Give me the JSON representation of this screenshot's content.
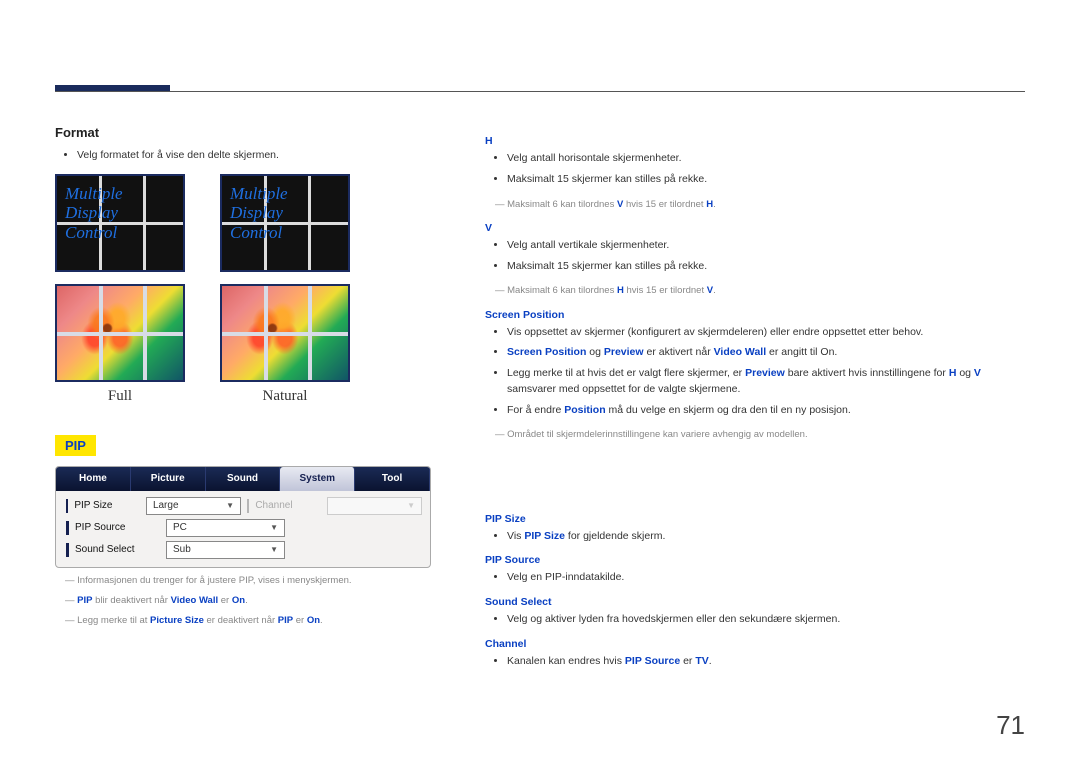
{
  "page_number": "71",
  "left": {
    "format_heading": "Format",
    "format_desc": "Velg formatet for å vise den delte skjermen.",
    "display_text": "Multiple\nDisplay\nControl",
    "label_full": "Full",
    "label_natural": "Natural",
    "pip_heading": "PIP",
    "tabs": {
      "home": "Home",
      "picture": "Picture",
      "sound": "Sound",
      "system": "System",
      "tool": "Tool"
    },
    "rows": {
      "pip_size": {
        "label": "PIP Size",
        "value": "Large"
      },
      "channel": {
        "label": "Channel",
        "value": ""
      },
      "pip_source": {
        "label": "PIP Source",
        "value": "PC"
      },
      "sound_select": {
        "label": "Sound Select",
        "value": "Sub"
      }
    },
    "notes": {
      "n1_pre": "Informasjonen du trenger for å justere PIP, vises i menyskjermen.",
      "n2_a": "PIP",
      "n2_b": " blir deaktivert når ",
      "n2_c": "Video Wall",
      "n2_d": " er ",
      "n2_e": "On",
      "n2_f": ".",
      "n3_a": "Legg merke til at ",
      "n3_b": "Picture Size",
      "n3_c": " er deaktivert når ",
      "n3_d": "PIP",
      "n3_e": " er ",
      "n3_f": "On",
      "n3_g": "."
    }
  },
  "right": {
    "h": {
      "head": "H",
      "b1": "Velg antall horisontale skjermenheter.",
      "b2": "Maksimalt 15 skjermer kan stilles på rekke.",
      "note_a": "Maksimalt 6 kan tilordnes ",
      "note_b": "V",
      "note_c": " hvis 15 er tilordnet ",
      "note_d": "H",
      "note_e": "."
    },
    "v": {
      "head": "V",
      "b1": "Velg antall vertikale skjermenheter.",
      "b2": "Maksimalt 15 skjermer kan stilles på rekke.",
      "note_a": "Maksimalt 6 kan tilordnes ",
      "note_b": "H",
      "note_c": " hvis 15 er tilordnet ",
      "note_d": "V",
      "note_e": "."
    },
    "sp": {
      "head": "Screen Position",
      "b1": "Vis oppsettet av skjermer (konfigurert av skjermdeleren) eller endre oppsettet etter behov.",
      "b2_a": "Screen Position",
      "b2_b": " og ",
      "b2_c": "Preview",
      "b2_d": " er aktivert når ",
      "b2_e": "Video Wall",
      "b2_f": " er angitt til On.",
      "b3_a": "Legg merke til at hvis det er valgt flere skjermer, er ",
      "b3_b": "Preview",
      "b3_c": " bare aktivert hvis innstillingene for ",
      "b3_d": "H",
      "b3_e": " og ",
      "b3_f": "V",
      "b3_g": " samsvarer med oppsettet for de valgte skjermene.",
      "b4_a": "For å endre ",
      "b4_b": "Position",
      "b4_c": " må du velge en skjerm og dra den til en ny posisjon.",
      "note": "Området til skjermdelerinnstillingene kan variere avhengig av modellen."
    },
    "pipsize": {
      "head": "PIP Size",
      "b1_a": "Vis ",
      "b1_b": "PIP Size",
      "b1_c": " for gjeldende skjerm."
    },
    "pipsource": {
      "head": "PIP Source",
      "b1": "Velg en PIP-inndatakilde."
    },
    "sound": {
      "head": "Sound Select",
      "b1": "Velg og aktiver lyden fra hovedskjermen eller den sekundære skjermen."
    },
    "channel": {
      "head": "Channel",
      "b1_a": "Kanalen kan endres hvis ",
      "b1_b": "PIP Source",
      "b1_c": " er ",
      "b1_d": "TV",
      "b1_e": "."
    }
  }
}
